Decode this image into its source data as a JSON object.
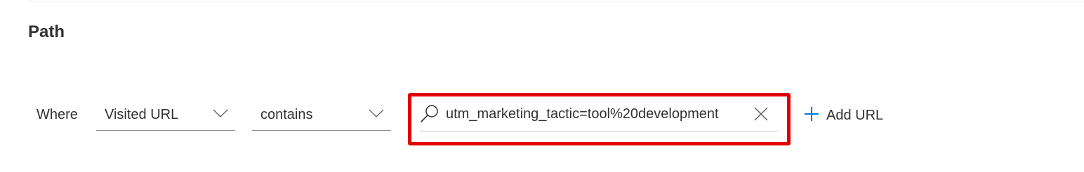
{
  "section": {
    "title": "Path"
  },
  "filter": {
    "where_label": "Where",
    "field_dropdown": {
      "selected": "Visited URL",
      "icon": "chevron-down-icon"
    },
    "operator_dropdown": {
      "selected": "contains",
      "icon": "chevron-down-icon"
    },
    "url_search": {
      "value": "utm_marketing_tactic=tool%20development",
      "search_icon": "search-icon",
      "clear_icon": "close-icon"
    },
    "add_url": {
      "label": "Add URL",
      "icon": "plus-icon"
    }
  },
  "colors": {
    "highlight_border": "#e00000",
    "accent": "#0078d4",
    "text": "#323130"
  }
}
